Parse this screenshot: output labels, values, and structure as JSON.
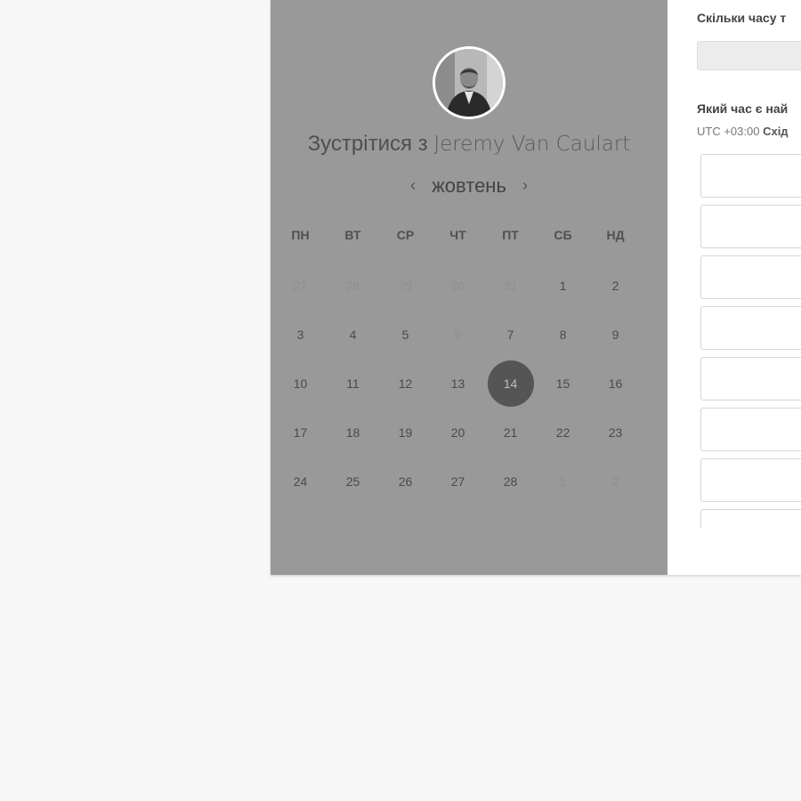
{
  "scheduler": {
    "title_prefix": "Зустрітися з",
    "host_name": "Jeremy Van Caulart",
    "month": "жовтень",
    "prev_icon": "‹",
    "next_icon": "›",
    "weekdays": [
      "ПН",
      "ВТ",
      "СР",
      "ЧТ",
      "ПТ",
      "СБ",
      "НД"
    ],
    "days": [
      {
        "label": "27",
        "muted": true
      },
      {
        "label": "28",
        "muted": true
      },
      {
        "label": "29",
        "muted": true
      },
      {
        "label": "30",
        "muted": true
      },
      {
        "label": "31",
        "muted": true
      },
      {
        "label": "1"
      },
      {
        "label": "2"
      },
      {
        "label": "3"
      },
      {
        "label": "4"
      },
      {
        "label": "5"
      },
      {
        "label": "6",
        "muted": true
      },
      {
        "label": "7"
      },
      {
        "label": "8"
      },
      {
        "label": "9"
      },
      {
        "label": "10"
      },
      {
        "label": "11"
      },
      {
        "label": "12"
      },
      {
        "label": "13"
      },
      {
        "label": "14",
        "selected": true
      },
      {
        "label": "15"
      },
      {
        "label": "16"
      },
      {
        "label": "17"
      },
      {
        "label": "18"
      },
      {
        "label": "19"
      },
      {
        "label": "20"
      },
      {
        "label": "21"
      },
      {
        "label": "22"
      },
      {
        "label": "23"
      },
      {
        "label": "24"
      },
      {
        "label": "25"
      },
      {
        "label": "26"
      },
      {
        "label": "27"
      },
      {
        "label": "28"
      },
      {
        "label": "1",
        "muted": true
      },
      {
        "label": "2",
        "muted": true
      }
    ]
  },
  "booking": {
    "duration_label": "Скільки часу т",
    "duration_value": "",
    "best_time_label": "Який час є най",
    "timezone_offset": "UTC +03:00",
    "timezone_name": "Схід",
    "slot_count": 8
  },
  "colors": {
    "overlay": "#999999",
    "selected_day": "#555555",
    "page_bg": "#f7f7f7"
  }
}
